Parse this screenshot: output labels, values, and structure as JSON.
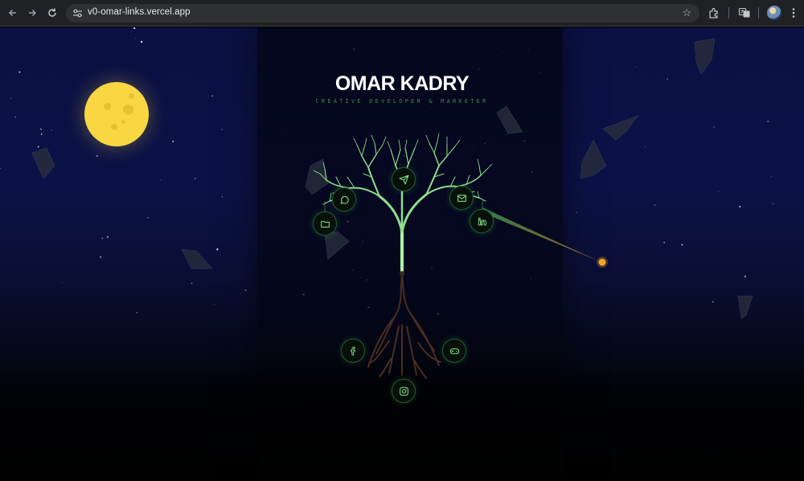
{
  "browser": {
    "url": "v0-omar-links.vercel.app",
    "icons": [
      "back-arrow-icon",
      "forward-arrow-icon",
      "reload-icon",
      "site-settings-icon",
      "bookmark-star-icon",
      "extensions-icon",
      "translate-icon",
      "profile-avatar",
      "more-menu-icon"
    ]
  },
  "page": {
    "title": "OMAR KADRY",
    "subtitle": "CREATIVE DEVELOPER & MARKETER",
    "colors": {
      "sky_top": "#0b1142",
      "ground": "#010101",
      "moon": "#f8d743",
      "branch": "#8de08c",
      "trunk_glow": "#9af09a",
      "root": "#5a3a2a",
      "node_border": "#255c2c",
      "icon": "#7ee081",
      "comet": "#f5a623",
      "comet_trail": "#2f8f5a"
    },
    "link_nodes": [
      {
        "icon": "send-icon",
        "kind": "branch"
      },
      {
        "icon": "chat-bubble-icon",
        "kind": "branch"
      },
      {
        "icon": "folder-icon",
        "kind": "branch"
      },
      {
        "icon": "mail-icon",
        "kind": "branch"
      },
      {
        "icon": "linkedin-icon",
        "kind": "branch"
      },
      {
        "icon": "facebook-icon",
        "kind": "root"
      },
      {
        "icon": "gamepad-icon",
        "kind": "root"
      },
      {
        "icon": "instagram-icon",
        "kind": "root"
      }
    ]
  }
}
